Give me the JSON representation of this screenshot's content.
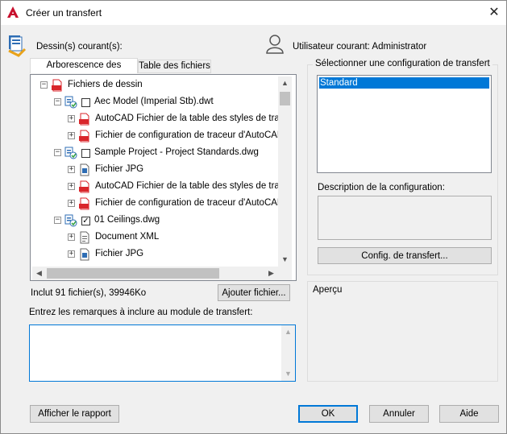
{
  "window": {
    "title": "Créer un transfert",
    "close_label": "✕"
  },
  "header": {
    "current_drawings_label": "Dessin(s) courant(s):",
    "current_user_label": "Utilisateur courant: Administrator"
  },
  "tabs": [
    {
      "label": "Arborescence des fichiers"
    },
    {
      "label": "Table des fichiers"
    }
  ],
  "tree": {
    "rows": [
      {
        "label": "Fichiers de dessin",
        "icon": "dwt-file-icon"
      },
      {
        "label": "Aec Model (Imperial Stb).dwt",
        "icon": "drawing-set-icon",
        "checked": false
      },
      {
        "label": "AutoCAD Fichier de la table des styles de tracé",
        "icon": "stb-file-icon"
      },
      {
        "label": "Fichier de configuration de traceur d'AutoCAD",
        "icon": "pc3-file-icon"
      },
      {
        "label": "Sample Project - Project Standards.dwg",
        "icon": "drawing-set-icon",
        "checked": false
      },
      {
        "label": "Fichier JPG",
        "icon": "jpg-file-icon"
      },
      {
        "label": "AutoCAD Fichier de la table des styles de tracé",
        "icon": "stb-file-icon"
      },
      {
        "label": "Fichier de configuration de traceur d'AutoCAD",
        "icon": "pc3-file-icon"
      },
      {
        "label": "01 Ceilings.dwg",
        "icon": "drawing-set-icon",
        "checked": true
      },
      {
        "label": "Document XML",
        "icon": "xml-file-icon"
      },
      {
        "label": "Fichier JPG",
        "icon": "jpg-file-icon"
      }
    ]
  },
  "summary": {
    "text": "Inclut 91 fichier(s), 39946Ko",
    "add_file_button": "Ajouter fichier..."
  },
  "remarks": {
    "label": "Entrez les remarques à inclure au module de transfert:",
    "value": ""
  },
  "config": {
    "select_label": "Sélectionner une configuration de transfert",
    "items": [
      "Standard"
    ],
    "description_label": "Description de la configuration:",
    "setup_button": "Config. de transfert..."
  },
  "preview": {
    "label": "Aperçu"
  },
  "footer": {
    "report_button": "Afficher le rapport",
    "ok_button": "OK",
    "cancel_button": "Annuler",
    "help_button": "Aide"
  },
  "colors": {
    "accent": "#0078d7",
    "app_red": "#c8102e",
    "file_red": "#d9262b"
  }
}
